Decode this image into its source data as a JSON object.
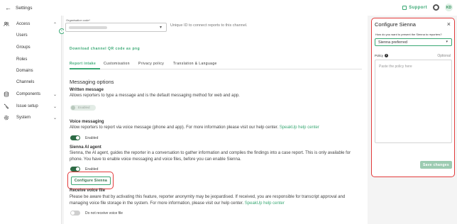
{
  "header": {
    "back_label": "Settings",
    "support_label": "Support",
    "avatar_initials": "KD"
  },
  "sidebar": {
    "sections": [
      {
        "label": "Access",
        "icon": "people-icon",
        "items": [
          "Users",
          "Groups",
          "Roles",
          "Domains",
          "Channels"
        ]
      },
      {
        "label": "Components",
        "icon": "database-icon"
      },
      {
        "label": "Issue setup",
        "icon": "tools-icon"
      },
      {
        "label": "System",
        "icon": "gear-icon"
      }
    ]
  },
  "main": {
    "org_code_label": "Organisation code*",
    "org_code_hint": "Unique ID to connect reports to this channel.",
    "download_label": "Download channel QR code as png",
    "tabs": [
      "Report intake",
      "Customisation",
      "Privacy policy",
      "Translation & Language"
    ],
    "active_tab": "Report intake",
    "section_title": "Messaging options",
    "written": {
      "title": "Written message",
      "desc": "Allows reporters to type a message and is the default messaging method for web and app.",
      "toggle_label": "Enabled"
    },
    "voice": {
      "title": "Voice messaging",
      "desc": "Allow reporters to report via voice message (phone and app). For more information please visit our help center.",
      "link": "SpeakUp help center",
      "toggle_label": "Enabled"
    },
    "ai": {
      "title": "Sienna AI agent",
      "desc_1": "Sienna, the AI agent, guides the reporter in a conversation to gather information and compiles the findings into a case report. This is only available for",
      "desc_2": "phone. You have to enable voice messaging and voice files, before you can enable Sienna.",
      "toggle_label": "Enabled",
      "configure_label": "Configure Sienna"
    },
    "voice_file": {
      "title": "Receive voice file",
      "desc_1": "Please be aware that by activating this feature, reporter anonymity may be jeopardised. If received, you are responsible for transcript approval and",
      "desc_2": "managing voice file storage in the system. For more information, please visit our help center.",
      "link": "SpeakUp help center",
      "toggle_label": "Do not receive voice file"
    }
  },
  "panel": {
    "title": "Configure Sienna",
    "question": "How do you want to present the Sienna to reporters?",
    "selected": "Sienna preferred",
    "policy_label": "Policy",
    "optional": "Optional",
    "placeholder": "Paste the policy here",
    "save_label": "Save changes"
  }
}
